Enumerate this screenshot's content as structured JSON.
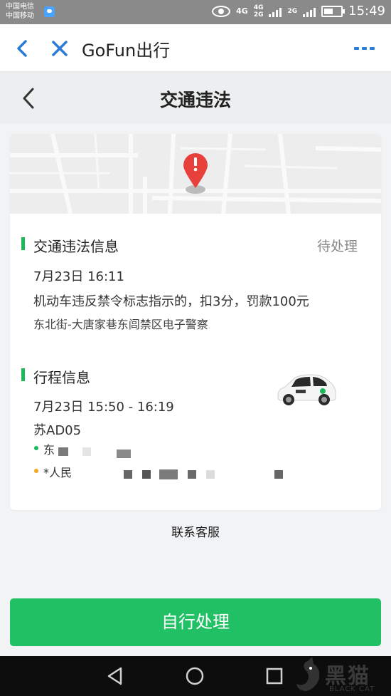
{
  "status_bar": {
    "carrier1": "中国电信",
    "carrier2": "中国移动",
    "net1": "4G",
    "net2": "4G",
    "net3": "2G",
    "net4": "2G",
    "time": "15:49"
  },
  "nav": {
    "title": "GoFun出行",
    "back_icon": "chevron-left-icon",
    "close_icon": "close-icon",
    "more_icon": "more-icon"
  },
  "page": {
    "title": "交通违法"
  },
  "violation": {
    "section_title": "交通违法信息",
    "status": "待处理",
    "datetime": "7月23日 16:11",
    "description": "机动车违反禁令标志指示的，扣3分，罚款100元",
    "location": "东北街-大唐家巷东闾禁区电子警察"
  },
  "trip": {
    "section_title": "行程信息",
    "time_range": "7月23日 15:50 - 16:19",
    "plate": "苏AD05",
    "start_address": "东",
    "end_address": "*人民"
  },
  "contact_label": "联系客服",
  "action_button": "自行处理",
  "watermark": {
    "text": "黑猫",
    "sub": "BLACK CAT"
  },
  "colors": {
    "accent": "#22c064",
    "nav_blue": "#2a7cd8",
    "pin_red": "#e8413b",
    "start_dot": "#1aba5b",
    "end_dot": "#f5a623"
  }
}
